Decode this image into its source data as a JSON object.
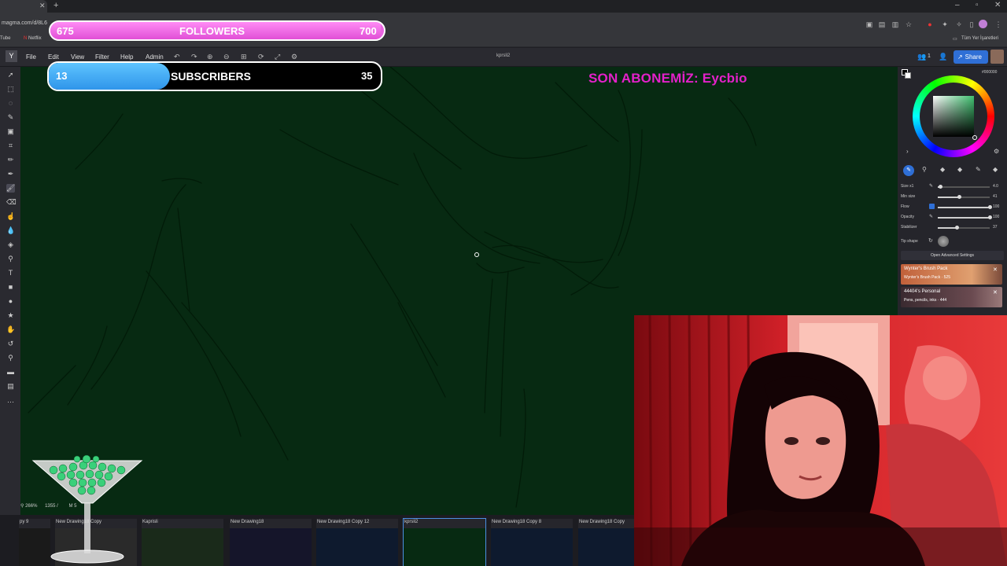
{
  "browser": {
    "url": "magma.com/d/8L6",
    "bookmarks": [
      "Tube",
      "Netflix"
    ],
    "bookmarks_right": "Tüm Yer İşaretleri"
  },
  "app": {
    "menu": [
      "File",
      "Edit",
      "View",
      "Filter",
      "Help",
      "Admin"
    ],
    "doc_name": "kprsli2",
    "users_count": "1",
    "share_label": "Share"
  },
  "color_panel": {
    "hex": "#000000",
    "accent": "#3fbf6f"
  },
  "brush_settings": {
    "rows": [
      {
        "label": "Size x1",
        "value": "4.0",
        "fraction": 0.04
      },
      {
        "label": "Min size",
        "value": "41",
        "fraction": 0.41
      },
      {
        "label": "Flow",
        "value": "100",
        "fraction": 1.0
      },
      {
        "label": "Opacity",
        "value": "100",
        "fraction": 1.0
      },
      {
        "label": "Stabilizer",
        "value": "37",
        "fraction": 0.37
      }
    ],
    "tip_shape_label": "Tip shape",
    "advanced_button": "Open Advanced Settings"
  },
  "brush_packs": [
    {
      "title": "Wynter's Brush Pack",
      "subtitle": "Wynter's Brush Pack · 525"
    },
    {
      "title": "44404's Personal",
      "subtitle": "Pens, pencils, inks · 444"
    }
  ],
  "status": {
    "zoom": "266%",
    "coords": "1355 /",
    "layer": "M 5"
  },
  "thumbnails": [
    {
      "label": "py 9"
    },
    {
      "label": "New Drawing18 Copy"
    },
    {
      "label": "Kaprisli"
    },
    {
      "label": "New Drawing18"
    },
    {
      "label": "New Drawing18 Copy 12"
    },
    {
      "label": "kprsli2"
    },
    {
      "label": "New Drawing18 Copy 8"
    },
    {
      "label": "New Drawing18 Copy"
    }
  ],
  "overlay": {
    "followers": {
      "current": "675",
      "label": "FOLLOWERS",
      "goal": "700"
    },
    "subscribers": {
      "current": "13",
      "label": "SUBSCRIBERS",
      "goal": "35"
    },
    "last_sub": "SON ABONEMİZ: Eycbio"
  }
}
